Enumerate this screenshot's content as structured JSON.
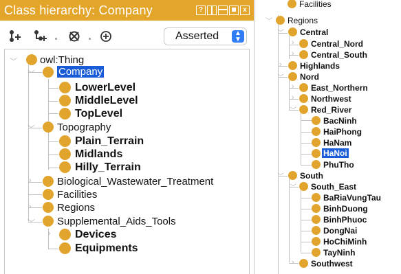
{
  "left": {
    "title": "Class hierarchy: Company",
    "window_buttons": [
      "?",
      "",
      "",
      "",
      "x"
    ],
    "asserted_select": {
      "value": "Asserted"
    },
    "tree": {
      "root": "owl:Thing",
      "company": "Company",
      "company_children": [
        "LowerLevel",
        "MiddleLevel",
        "TopLevel"
      ],
      "topography": "Topography",
      "topography_children": [
        "Plain_Terrain",
        "Midlands",
        "Hilly_Terrain"
      ],
      "biological": "Biological_Wastewater_Treatment",
      "facilities": "Facilities",
      "regions": "Regions",
      "supplemental": "Supplemental_Aids_Tools",
      "supplemental_children": [
        "Devices",
        "Equipments"
      ]
    }
  },
  "right": {
    "tree": {
      "facilities_partial": "Facilities",
      "regions": "Regions",
      "central": "Central",
      "central_children": [
        "Central_Nord",
        "Central_South"
      ],
      "highlands": "Highlands",
      "nord": "Nord",
      "nord_children": [
        "East_Northern",
        "Northwest"
      ],
      "red_river": "Red_River",
      "red_river_children": [
        "BacNinh",
        "HaiPhong",
        "HaNam",
        "HaNoi",
        "PhuTho"
      ],
      "south": "South",
      "south_east": "South_East",
      "south_east_children": [
        "BaRiaVungTau",
        "BinhDuong",
        "BinhPhuoc",
        "DongNai",
        "HoChiMinh",
        "TayNinh"
      ],
      "southwest": "Southwest"
    }
  },
  "colors": {
    "title_bar": "#e4a52b",
    "node": "#e1a52d",
    "selection": "#1a5cd8",
    "select_arrow": "#2f7cf6"
  },
  "icons": {
    "toolbar": [
      "add-subclass-icon",
      "add-sibling-class-icon",
      "delete-class-icon",
      "plus-circle-icon"
    ]
  }
}
